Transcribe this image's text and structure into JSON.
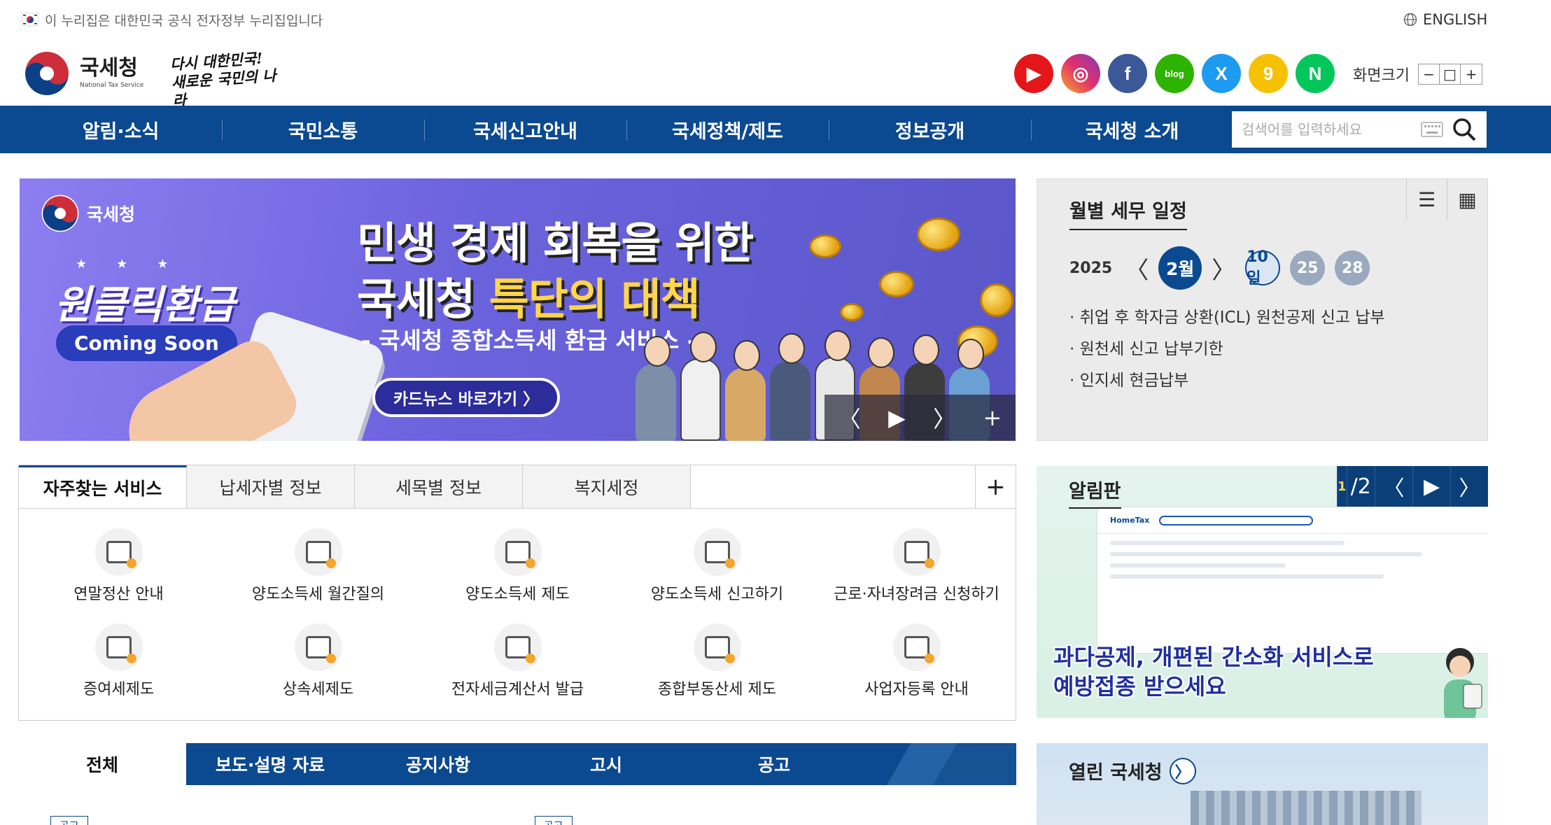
{
  "top_strip": {
    "gov_notice": "이 누리집은 대한민국 공식 전자정부 누리집입니다",
    "language": "ENGLISH"
  },
  "header": {
    "logo_name": "국세청",
    "logo_sub": "National Tax Service",
    "slogan_line1": "다시 대한민국!",
    "slogan_line2": "새로운 국민의 나라",
    "socials": [
      {
        "name": "youtube-icon",
        "glyph": "▶",
        "color": "#e5161a"
      },
      {
        "name": "instagram-icon",
        "glyph": "◎",
        "color": "#c837ab"
      },
      {
        "name": "facebook-icon",
        "glyph": "f",
        "color": "#3b5998"
      },
      {
        "name": "blog-icon",
        "glyph": "blog",
        "color": "#2db400"
      },
      {
        "name": "x-icon",
        "glyph": "X",
        "color": "#1da1f2"
      },
      {
        "name": "kakao-story-icon",
        "glyph": "9",
        "color": "#f6c100"
      },
      {
        "name": "naver-icon",
        "glyph": "N",
        "color": "#03c75a"
      }
    ],
    "font_size_label": "화면크기",
    "font_size_buttons": [
      "−",
      "□",
      "+"
    ]
  },
  "nav": {
    "items": [
      "알림·소식",
      "국민소통",
      "국세신고안내",
      "국세정책/제도",
      "정보공개",
      "국세청 소개"
    ],
    "search_placeholder": "검색어를 입력하세요"
  },
  "banner": {
    "brand": "국세청",
    "stars": "★★★",
    "one_click": "원클릭환급",
    "coming_soon": "Coming Soon",
    "title_line1": "민생 경제 회복을 위한",
    "title_line2_a": "국세청 ",
    "title_line2_b": "특단의 대책",
    "subtitle": "- 국세청 종합소득세 환급 서비스 -",
    "button": "카드뉴스 바로가기 〉",
    "controls": [
      "〈",
      "▶",
      "〉",
      "+"
    ]
  },
  "schedule": {
    "title": "월별 세무 일정",
    "view_icons": [
      "☰",
      "▦"
    ],
    "year": "2025",
    "month": "2월",
    "days": [
      "10일",
      "25",
      "28"
    ],
    "items": [
      "취업 후 학자금 상환(ICL) 원천공제 신고 납부",
      "원천세 신고 납부기한",
      "인지세 현금납부"
    ]
  },
  "services": {
    "tabs": [
      "자주찾는 서비스",
      "납세자별 정보",
      "세목별 정보",
      "복지세정"
    ],
    "plus": "+",
    "items": [
      "연말정산 안내",
      "양도소득세 월간질의",
      "양도소득세 제도",
      "양도소득세 신고하기",
      "근로·자녀장려금 신청하기",
      "증여세제도",
      "상속세제도",
      "전자세금계산서 발급",
      "종합부동산세 제도",
      "사업자등록 안내"
    ]
  },
  "board": {
    "title": "알림판",
    "page_current": "1",
    "page_total": "/2",
    "controls": [
      "〈",
      "▶",
      "〉"
    ],
    "mock_logo": "HomeTax",
    "text_line1": "과다공제, 개편된 간소화 서비스로",
    "text_line2": "예방접종 받으세요"
  },
  "news": {
    "tabs": [
      "전체",
      "보도·설명 자료",
      "공지사항",
      "고시",
      "공고"
    ],
    "row1_badge": "공고",
    "row2_badge": "공고"
  },
  "open_nts": {
    "title": "열린 국세청",
    "arrow": "〉"
  }
}
